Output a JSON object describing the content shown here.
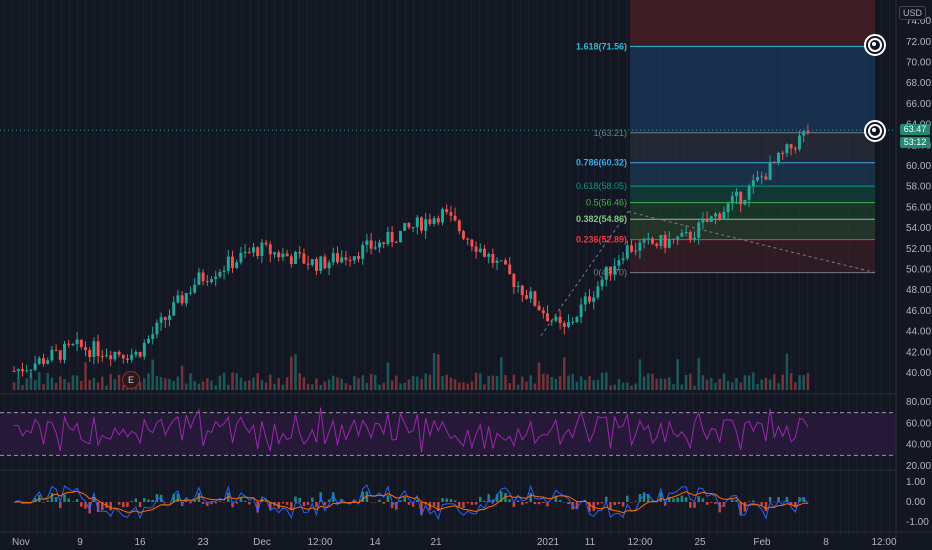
{
  "currency": "USD",
  "price_scale": [
    "74.00",
    "72.00",
    "70.00",
    "68.00",
    "66.00",
    "64.00",
    "62.00",
    "60.00",
    "58.00",
    "56.00",
    "54.00",
    "52.00",
    "50.00",
    "48.00",
    "46.00",
    "44.00",
    "42.00",
    "40.00"
  ],
  "rsi_scale": [
    "80.00",
    "60.00",
    "40.00",
    "20.00"
  ],
  "macd_scale": [
    "1.00",
    "0.00",
    "-1.00"
  ],
  "time_labels": [
    "Nov",
    "9",
    "16",
    "23",
    "Dec",
    "12:00",
    "14",
    "21",
    "2021",
    "11",
    "12:00",
    "25",
    "Feb",
    "8",
    "12:00"
  ],
  "last_price": "63.47",
  "countdown": "53:12",
  "earnings_label": "E",
  "fib_levels": [
    {
      "label": "1.618(71.56)",
      "value": 71.56,
      "color": "#2ebcd3",
      "bold": true
    },
    {
      "label": "1(63.21)",
      "value": 63.21,
      "color": "#787b86",
      "bold": false
    },
    {
      "label": "0.786(60.32)",
      "value": 60.32,
      "color": "#3ca9e8",
      "bold": true
    },
    {
      "label": "0.618(58.05)",
      "value": 58.05,
      "color": "#089981",
      "bold": false
    },
    {
      "label": "0.5(56.46)",
      "value": 56.46,
      "color": "#4caf50",
      "bold": false
    },
    {
      "label": "0.382(54.86)",
      "value": 54.86,
      "color": "#81c784",
      "bold": true
    },
    {
      "label": "0.236(52.89)",
      "value": 52.89,
      "color": "#f23645",
      "bold": true
    },
    {
      "label": "0(49.70)",
      "value": 49.7,
      "color": "#787b86",
      "bold": false
    }
  ],
  "colors": {
    "background": "#131722",
    "up": "#26a69a",
    "down": "#ef5350",
    "rsi_line": "#9c27b0",
    "macd_line": "#2962ff",
    "signal_line": "#ff6d00",
    "fib_top_zone": "#4a1e24",
    "fib_blue_zone": "#1b3a5c"
  },
  "chart_data": {
    "type": "line",
    "ylim": [
      39,
      75
    ],
    "x": [
      "Nov",
      "9",
      "16",
      "23",
      "Dec",
      "12:00",
      "14",
      "21",
      "2021",
      "11",
      "12:00",
      "25",
      "Feb",
      "8"
    ],
    "series": [
      {
        "values": [
          40.2,
          42.5,
          41.8,
          49.0,
          52.0,
          50.5,
          52.5,
          55.5,
          50.0,
          44.0,
          52.0,
          53.0,
          57.5,
          63.4
        ]
      }
    ],
    "rsi": {
      "ylim": [
        15,
        85
      ],
      "overbought": 70,
      "oversold": 30
    },
    "macd": {
      "ylim": [
        -1.4,
        1.4
      ]
    }
  }
}
